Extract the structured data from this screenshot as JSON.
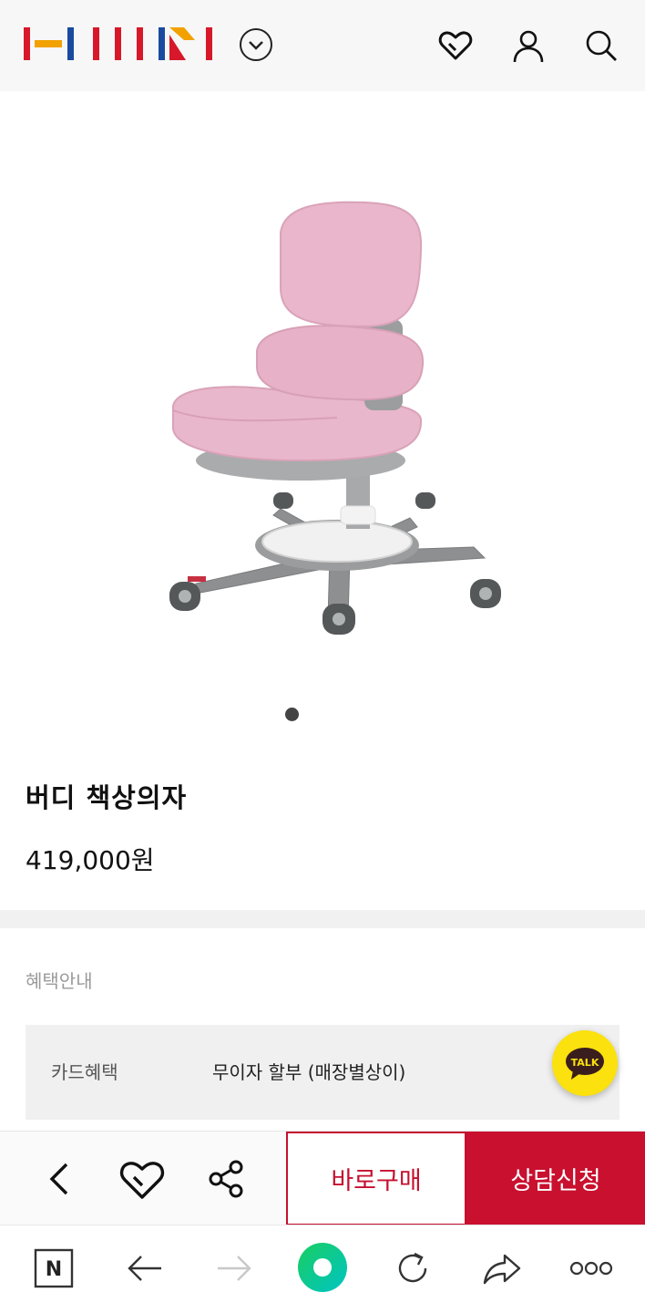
{
  "header": {
    "logo": "HANSSEM logo",
    "dropdown_icon": "chevron-down-circle-icon",
    "icons": [
      "heart-icon",
      "user-icon",
      "search-icon"
    ]
  },
  "product": {
    "image": "pink-kids-desk-chair",
    "carousel_count": 1,
    "carousel_active": 1,
    "title": "버디 책상의자",
    "price": "419,000원"
  },
  "benefits": {
    "heading": "혜택안내",
    "items": [
      {
        "label": "카드혜택",
        "value": "무이자 할부 (매장별상이)"
      }
    ]
  },
  "talk_button": {
    "label": "TALK"
  },
  "action_bar": {
    "buy_label": "바로구매",
    "consult_label": "상담신청"
  },
  "browser_bar": {
    "n_label": "N"
  },
  "colors": {
    "brand_red": "#c9102f",
    "kakao_yellow": "#fbe10d",
    "chair_pink": "#e8b4c8"
  }
}
